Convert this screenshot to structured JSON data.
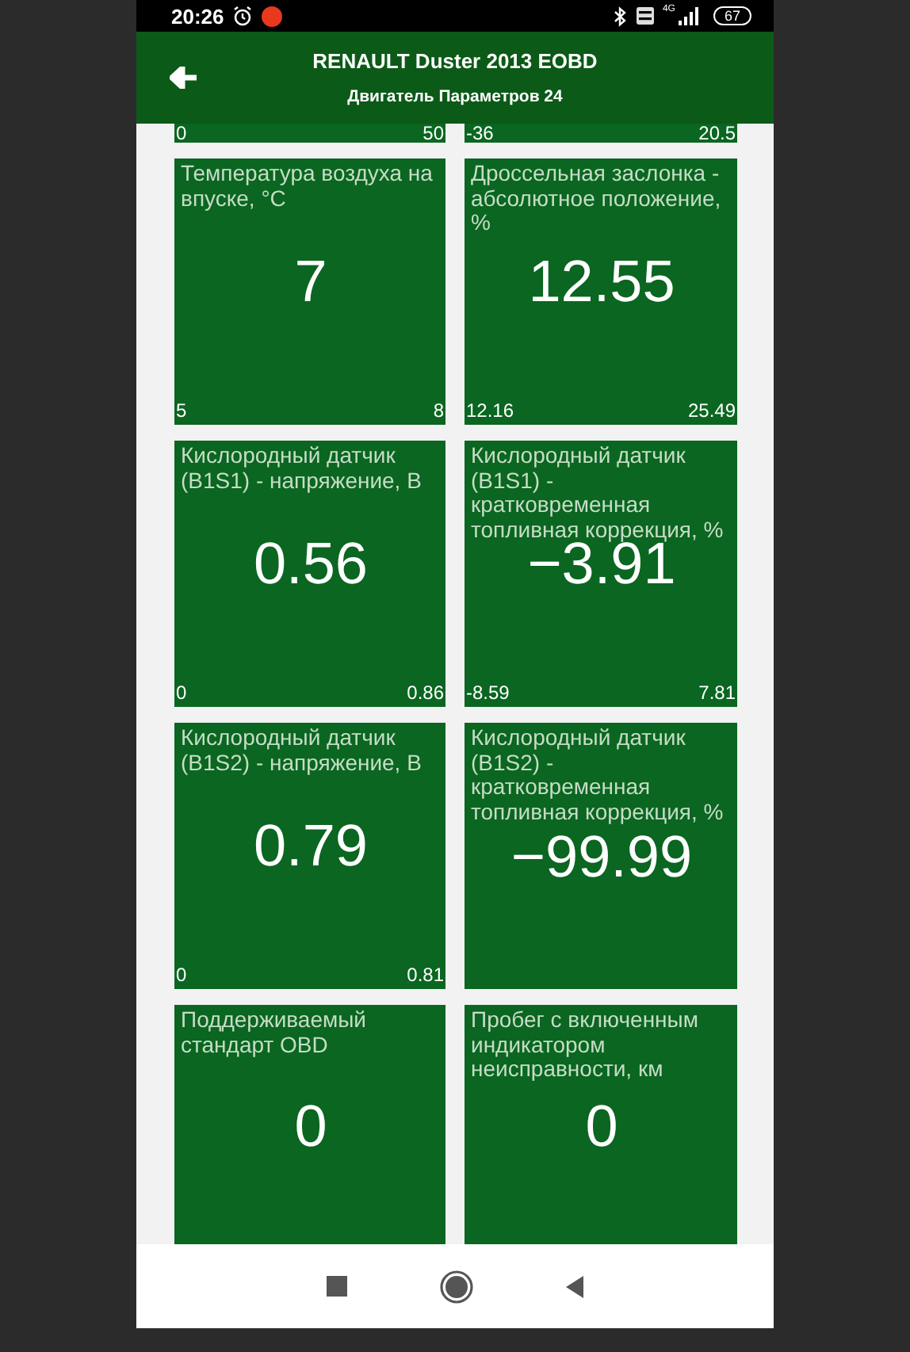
{
  "status_bar": {
    "time": "20:26",
    "network": "4G",
    "battery": "67"
  },
  "header": {
    "title": "RENAULT Duster 2013 EOBD",
    "subtitle": "Двигатель Параметров 24"
  },
  "tiles": [
    {
      "min": "0",
      "max": "50"
    },
    {
      "min": "-36",
      "max": "20.5"
    },
    {
      "title": "Температура воздуха на впуске, °C",
      "value": "7",
      "min": "5",
      "max": "8"
    },
    {
      "title": "Дроссельная заслонка - абсолютное положение, %",
      "value": "12.55",
      "min": "12.16",
      "max": "25.49"
    },
    {
      "title": "Кислородный датчик (B1S1) - напряжение, В",
      "value": "0.56",
      "min": "0",
      "max": "0.86"
    },
    {
      "title": "Кислородный датчик (B1S1) - кратковременная топливная коррекция, %",
      "value": "−3.91",
      "min": "-8.59",
      "max": "7.81"
    },
    {
      "title": "Кислородный датчик (B1S2) - напряжение, В",
      "value": "0.79",
      "min": "0",
      "max": "0.81"
    },
    {
      "title": "Кислородный датчик (B1S2) - кратковременная топливная коррекция, %",
      "value": "−99.99"
    },
    {
      "title": "Поддерживаемый стандарт OBD",
      "value": "0"
    },
    {
      "title": "Пробег с включенным индикатором неисправности, км",
      "value": "0"
    }
  ]
}
